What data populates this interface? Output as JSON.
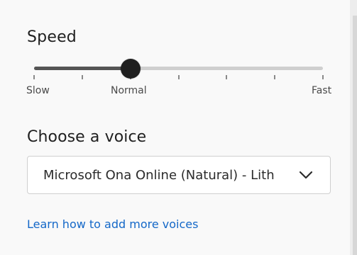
{
  "speed_section": {
    "title": "Speed",
    "slider": {
      "selected_level_index": 2,
      "level_count": 7,
      "labels": {
        "slow": "Slow",
        "normal": "Normal",
        "fast": "Fast"
      }
    }
  },
  "voice_section": {
    "title": "Choose a voice",
    "selected_voice": "Microsoft Ona Online (Natural) - Lith",
    "dropdown_icon": "chevron-down-icon"
  },
  "link": {
    "text": "Learn how to add more voices"
  },
  "colors": {
    "accent_link": "#1468c8",
    "slider_fill": "#555555",
    "slider_track": "#cfcfcf",
    "thumb": "#1f1f1f"
  }
}
